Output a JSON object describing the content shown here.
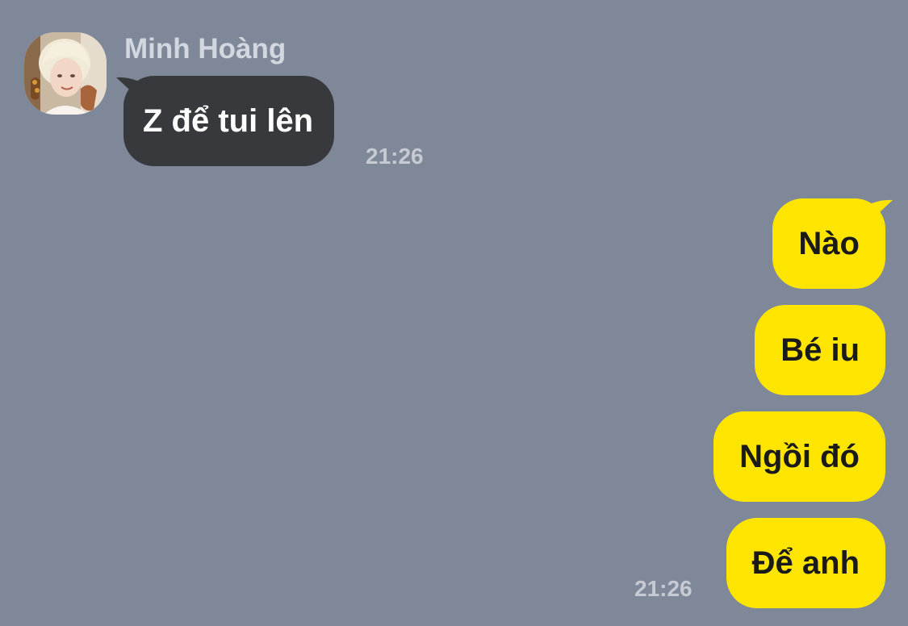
{
  "conversation": {
    "incoming": {
      "sender_name": "Minh Hoàng",
      "avatar": "profile-photo",
      "messages": [
        {
          "text": "Z để tui lên"
        }
      ],
      "time": "21:26"
    },
    "outgoing": {
      "messages": [
        {
          "text": "Nào"
        },
        {
          "text": "Bé iu"
        },
        {
          "text": "Ngồi đó"
        },
        {
          "text": "Để anh"
        }
      ],
      "time": "21:26"
    }
  },
  "colors": {
    "background": "#7f8899",
    "incoming_bubble": "#38393d",
    "outgoing_bubble": "#fee500",
    "timestamp": "#c6cad3"
  }
}
